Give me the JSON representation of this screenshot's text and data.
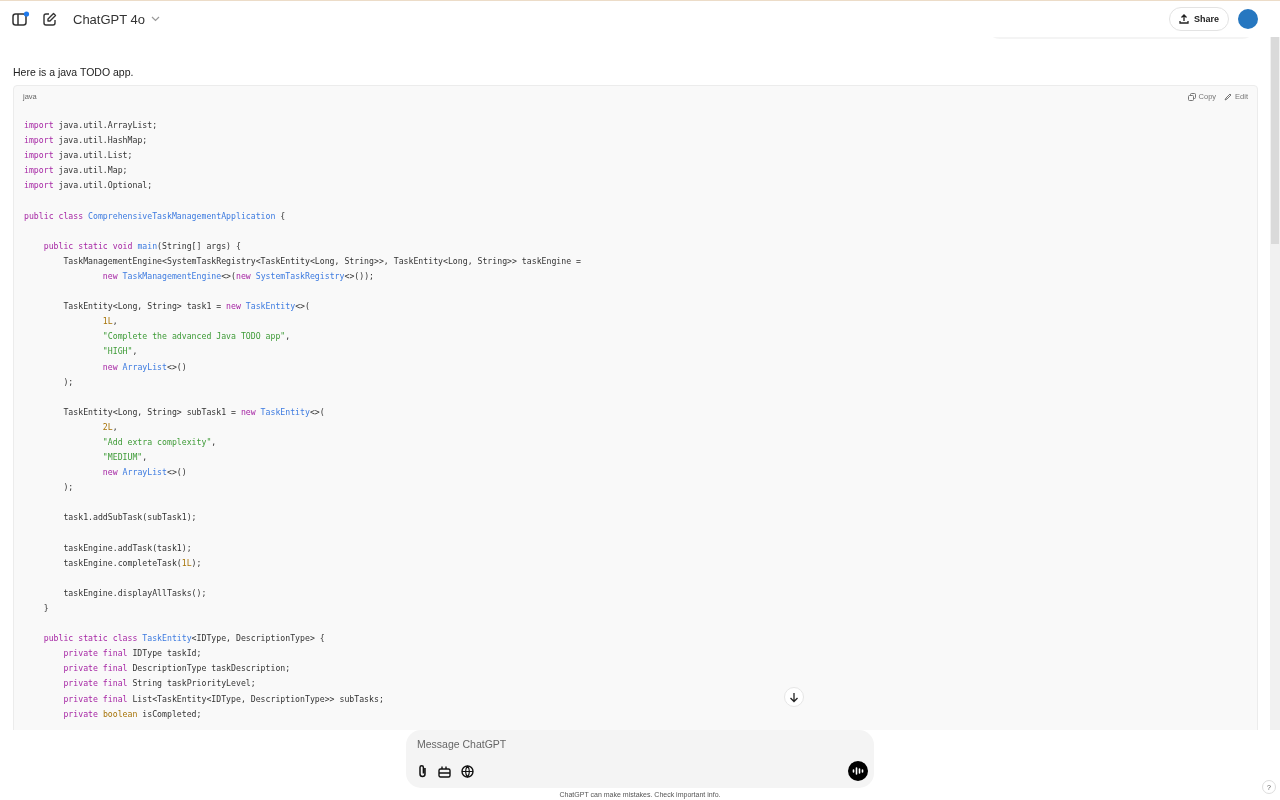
{
  "header": {
    "model_name": "ChatGPT 4o",
    "share_label": "Share"
  },
  "reply_text": "Here is a java TODO app.",
  "code_block": {
    "language": "java",
    "copy_label": "Copy",
    "edit_label": "Edit",
    "lines": [
      {
        "kind": "code",
        "tokens": [
          {
            "kind": "keyword",
            "text": "import"
          },
          {
            "kind": "plain",
            "text": " java.util.ArrayList;"
          }
        ]
      },
      {
        "kind": "code",
        "tokens": [
          {
            "kind": "keyword",
            "text": "import"
          },
          {
            "kind": "plain",
            "text": " java.util.HashMap;"
          }
        ]
      },
      {
        "kind": "code",
        "tokens": [
          {
            "kind": "keyword",
            "text": "import"
          },
          {
            "kind": "plain",
            "text": " java.util.List;"
          }
        ]
      },
      {
        "kind": "code",
        "tokens": [
          {
            "kind": "keyword",
            "text": "import"
          },
          {
            "kind": "plain",
            "text": " java.util.Map;"
          }
        ]
      },
      {
        "kind": "code",
        "tokens": [
          {
            "kind": "keyword",
            "text": "import"
          },
          {
            "kind": "plain",
            "text": " java.util.Optional;"
          }
        ]
      },
      {
        "kind": "blank"
      },
      {
        "kind": "code",
        "tokens": [
          {
            "kind": "keyword",
            "text": "public class"
          },
          {
            "kind": "name",
            "text": " ComprehensiveTaskManagementApplication"
          },
          {
            "kind": "plain",
            "text": " {"
          }
        ]
      },
      {
        "kind": "blank"
      },
      {
        "kind": "code",
        "tokens": [
          {
            "kind": "keyword",
            "text": "    public static void"
          },
          {
            "kind": "name",
            "text": " main"
          },
          {
            "kind": "plain",
            "text": "(String[] args) {"
          }
        ]
      },
      {
        "kind": "code",
        "tokens": [
          {
            "kind": "plain",
            "text": "        TaskManagementEngine<SystemTaskRegistry<TaskEntity<Long, String>>, TaskEntity<Long, String>> taskEngine ="
          }
        ]
      },
      {
        "kind": "code",
        "tokens": [
          {
            "kind": "keyword",
            "text": "                new"
          },
          {
            "kind": "name",
            "text": " TaskManagementEngine"
          },
          {
            "kind": "plain",
            "text": "<>("
          },
          {
            "kind": "keyword",
            "text": "new"
          },
          {
            "kind": "name",
            "text": " SystemTaskRegistry"
          },
          {
            "kind": "plain",
            "text": "<>());"
          }
        ]
      },
      {
        "kind": "blank"
      },
      {
        "kind": "code",
        "tokens": [
          {
            "kind": "plain",
            "text": "        TaskEntity<Long, String> task1 = "
          },
          {
            "kind": "keyword",
            "text": "new"
          },
          {
            "kind": "name",
            "text": " TaskEntity"
          },
          {
            "kind": "plain",
            "text": "<>("
          }
        ]
      },
      {
        "kind": "code",
        "tokens": [
          {
            "kind": "number",
            "text": "                1L"
          },
          {
            "kind": "plain",
            "text": ","
          }
        ]
      },
      {
        "kind": "code",
        "tokens": [
          {
            "kind": "string",
            "text": "                \"Complete the advanced Java TODO app\""
          },
          {
            "kind": "plain",
            "text": ","
          }
        ]
      },
      {
        "kind": "code",
        "tokens": [
          {
            "kind": "string",
            "text": "                \"HIGH\""
          },
          {
            "kind": "plain",
            "text": ","
          }
        ]
      },
      {
        "kind": "code",
        "tokens": [
          {
            "kind": "keyword",
            "text": "                new"
          },
          {
            "kind": "name",
            "text": " ArrayList"
          },
          {
            "kind": "plain",
            "text": "<>()"
          }
        ]
      },
      {
        "kind": "code",
        "tokens": [
          {
            "kind": "plain",
            "text": "        );"
          }
        ]
      },
      {
        "kind": "blank"
      },
      {
        "kind": "code",
        "tokens": [
          {
            "kind": "plain",
            "text": "        TaskEntity<Long, String> subTask1 = "
          },
          {
            "kind": "keyword",
            "text": "new"
          },
          {
            "kind": "name",
            "text": " TaskEntity"
          },
          {
            "kind": "plain",
            "text": "<>("
          }
        ]
      },
      {
        "kind": "code",
        "tokens": [
          {
            "kind": "number",
            "text": "                2L"
          },
          {
            "kind": "plain",
            "text": ","
          }
        ]
      },
      {
        "kind": "code",
        "tokens": [
          {
            "kind": "string",
            "text": "                \"Add extra complexity\""
          },
          {
            "kind": "plain",
            "text": ","
          }
        ]
      },
      {
        "kind": "code",
        "tokens": [
          {
            "kind": "string",
            "text": "                \"MEDIUM\""
          },
          {
            "kind": "plain",
            "text": ","
          }
        ]
      },
      {
        "kind": "code",
        "tokens": [
          {
            "kind": "keyword",
            "text": "                new"
          },
          {
            "kind": "name",
            "text": " ArrayList"
          },
          {
            "kind": "plain",
            "text": "<>()"
          }
        ]
      },
      {
        "kind": "code",
        "tokens": [
          {
            "kind": "plain",
            "text": "        );"
          }
        ]
      },
      {
        "kind": "blank"
      },
      {
        "kind": "code",
        "tokens": [
          {
            "kind": "plain",
            "text": "        task1.addSubTask(subTask1);"
          }
        ]
      },
      {
        "kind": "blank"
      },
      {
        "kind": "code",
        "tokens": [
          {
            "kind": "plain",
            "text": "        taskEngine.addTask(task1);"
          }
        ]
      },
      {
        "kind": "code",
        "tokens": [
          {
            "kind": "plain",
            "text": "        taskEngine.completeTask("
          },
          {
            "kind": "number",
            "text": "1L"
          },
          {
            "kind": "plain",
            "text": ");"
          }
        ]
      },
      {
        "kind": "blank"
      },
      {
        "kind": "code",
        "tokens": [
          {
            "kind": "plain",
            "text": "        taskEngine.displayAllTasks();"
          }
        ]
      },
      {
        "kind": "code",
        "tokens": [
          {
            "kind": "plain",
            "text": "    }"
          }
        ]
      },
      {
        "kind": "blank"
      },
      {
        "kind": "code",
        "tokens": [
          {
            "kind": "keyword",
            "text": "    public static class"
          },
          {
            "kind": "name",
            "text": " TaskEntity"
          },
          {
            "kind": "plain",
            "text": "<IDType, DescriptionType> {"
          }
        ]
      },
      {
        "kind": "code",
        "tokens": [
          {
            "kind": "keyword",
            "text": "        private final"
          },
          {
            "kind": "plain",
            "text": " IDType taskId;"
          }
        ]
      },
      {
        "kind": "code",
        "tokens": [
          {
            "kind": "keyword",
            "text": "        private final"
          },
          {
            "kind": "plain",
            "text": " DescriptionType taskDescription;"
          }
        ]
      },
      {
        "kind": "code",
        "tokens": [
          {
            "kind": "keyword",
            "text": "        private final"
          },
          {
            "kind": "plain",
            "text": " String taskPriorityLevel;"
          }
        ]
      },
      {
        "kind": "code",
        "tokens": [
          {
            "kind": "keyword",
            "text": "        private final"
          },
          {
            "kind": "plain",
            "text": " List<TaskEntity<IDType, DescriptionType>> subTasks;"
          }
        ]
      },
      {
        "kind": "code",
        "tokens": [
          {
            "kind": "keyword",
            "text": "        private"
          },
          {
            "kind": "number",
            "text": " boolean"
          },
          {
            "kind": "plain",
            "text": " isCompleted;"
          }
        ]
      }
    ]
  },
  "composer": {
    "placeholder": "Message ChatGPT"
  },
  "disclaimer": "ChatGPT can make mistakes. Check important info.",
  "help_label": "?"
}
